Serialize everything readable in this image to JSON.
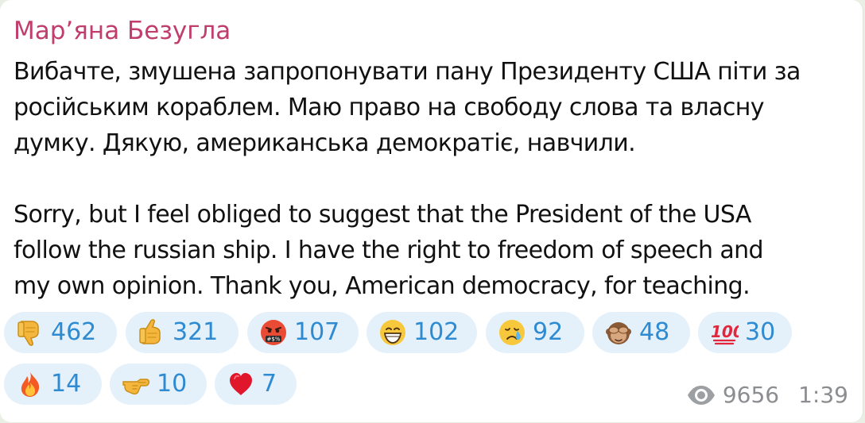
{
  "message": {
    "author": "Мар’яна Безугла",
    "paragraphs": [
      [
        "Вибачте, змушена запропонувати пану Президенту США піти за",
        "російським кораблем. Маю право на свободу слова та власну",
        "думку. Дякую, американська демократіє, навчили."
      ],
      [
        "Sorry, but I feel obliged to suggest that the President of the USA",
        "follow the russian ship. I have the right to freedom of speech and",
        "my own opinion. Thank you, American democracy, for teaching."
      ]
    ],
    "views": "9656",
    "time": "1:39"
  },
  "reactions": [
    {
      "emoji": "thumbs-down",
      "count": "462"
    },
    {
      "emoji": "thumbs-up",
      "count": "321"
    },
    {
      "emoji": "face-with-symbols-on-mouth",
      "count": "107"
    },
    {
      "emoji": "grinning-face",
      "count": "102"
    },
    {
      "emoji": "crying-face",
      "count": "92"
    },
    {
      "emoji": "see-no-evil-monkey",
      "count": "48"
    },
    {
      "emoji": "hundred-points",
      "count": "30"
    },
    {
      "emoji": "fire",
      "count": "14"
    },
    {
      "emoji": "pointing-hand",
      "count": "10"
    },
    {
      "emoji": "red-heart",
      "count": "7"
    }
  ],
  "colors": {
    "author": "#c03d6c",
    "reaction_background": "#e4f1fb",
    "reaction_count": "#2e8bd1",
    "meta": "#8b8d90"
  }
}
